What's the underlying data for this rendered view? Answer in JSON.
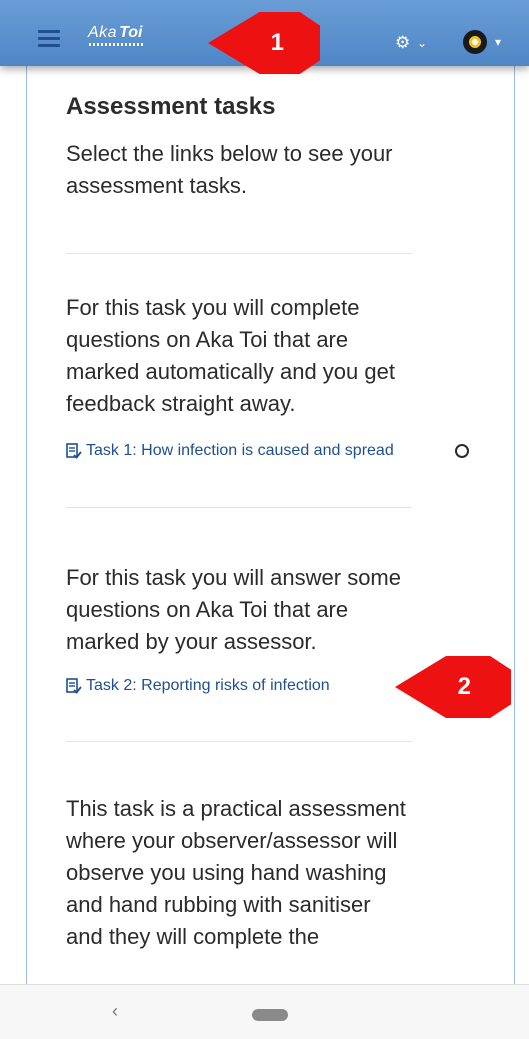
{
  "navbar": {
    "logo_text_regular": "Aka",
    "logo_text_bold": "Toi",
    "settings_icon": "gear-icon",
    "user_icon": "avatar"
  },
  "callouts": {
    "first": "1",
    "second": "2"
  },
  "main": {
    "title": "Assessment tasks",
    "intro": "Select the links below to see your assessment tasks.",
    "tasks": [
      {
        "description": "For this task you will complete questions on Aka Toi that are marked automatically and you get feedback straight away.",
        "link_label": "Task 1: How infection is caused and spread",
        "completion": "not-completed"
      },
      {
        "description": "For this task you will answer some questions on Aka Toi that are marked by your assessor.",
        "link_label": "Task 2: Reporting risks of infection"
      },
      {
        "description": "This task is a practical assessment where your observer/assessor will observe you using hand washing and hand rubbing with sanitiser and they will complete the"
      }
    ]
  },
  "colors": {
    "navbar": "#5a8fcc",
    "link": "#1f4f8f",
    "callout": "#ee1111"
  }
}
